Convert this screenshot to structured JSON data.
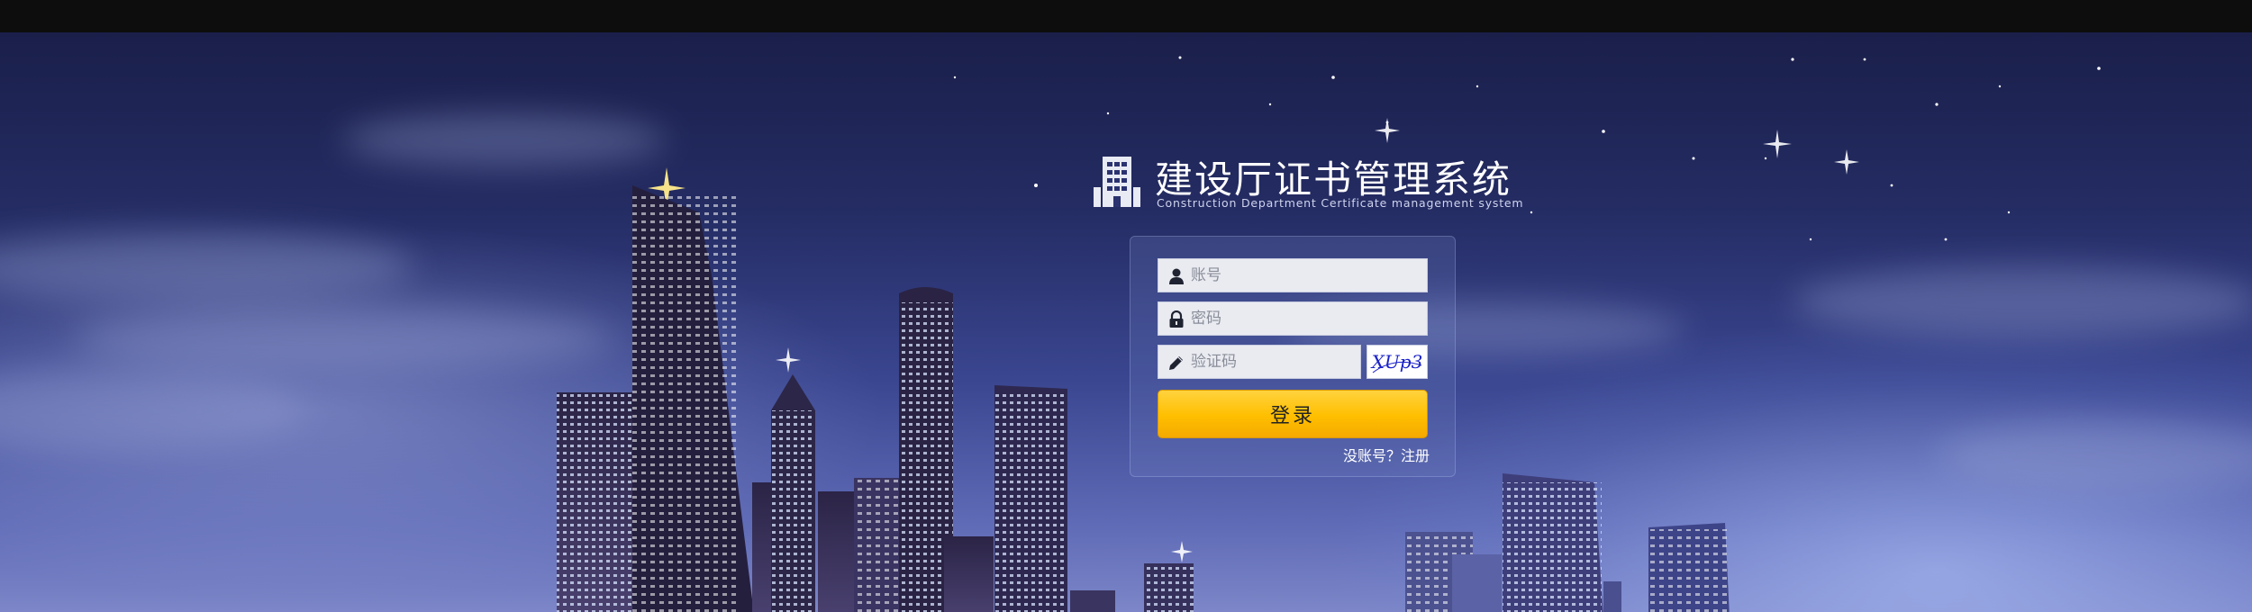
{
  "app": {
    "title": "建设厅证书管理系统",
    "subtitle": "Construction Department Certificate management system",
    "logo_icon": "building-icon"
  },
  "login": {
    "username_placeholder": "账号",
    "password_placeholder": "密码",
    "captcha_placeholder": "验证码",
    "captcha_text": "XUp3",
    "submit_label": "登录",
    "register_link": "没账号？注册",
    "icons": {
      "username": "user-icon",
      "password": "lock-icon",
      "captcha": "pencil-icon"
    }
  },
  "colors": {
    "button": "#ffbf00",
    "input_bg": "#e9ebf1",
    "captcha_text": "#1a22c8"
  }
}
